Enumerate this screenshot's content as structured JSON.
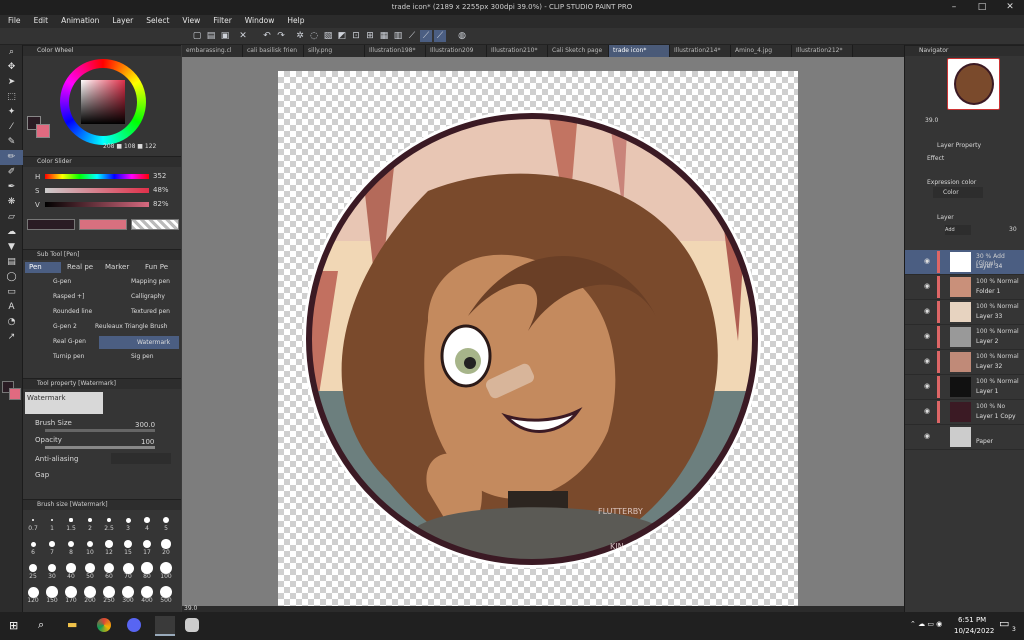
{
  "window": {
    "title": "trade icon* (2189 x 2255px 300dpi 39.0%) - CLIP STUDIO PAINT PRO",
    "minimize": "–",
    "maximize": "□",
    "close": "✕"
  },
  "menu": [
    "File",
    "Edit",
    "Animation",
    "Layer",
    "Select",
    "View",
    "Filter",
    "Window",
    "Help"
  ],
  "tabs": [
    {
      "label": "embarassing.cl"
    },
    {
      "label": "cali basilisk frien"
    },
    {
      "label": "silly.png"
    },
    {
      "label": "Illustration198*"
    },
    {
      "label": "Illustration209"
    },
    {
      "label": "Illustration210*"
    },
    {
      "label": "Cali Sketch page"
    },
    {
      "label": "trade icon*",
      "active": true
    },
    {
      "label": "Illustration214*"
    },
    {
      "label": "Amino_4.jpg"
    },
    {
      "label": "Illustration212*"
    }
  ],
  "color_wheel": {
    "title": "Color Wheel",
    "h": "208",
    "s": "108",
    "v": "122",
    "main_color": "#2a1c24",
    "sub_color": "#e06a80"
  },
  "color_slider": {
    "title": "Color Slider",
    "h_label": "H",
    "s_label": "S",
    "v_label": "V",
    "h": "352",
    "s": "48%",
    "v": "82%"
  },
  "sub_tool": {
    "title": "Sub Tool [Pen]",
    "tabs": [
      "Pen",
      "Real pe",
      "Marker",
      "Fun Pe"
    ],
    "brushes": [
      "G-pen",
      "Mapping pen",
      "Rasped +]",
      "Calligraphy",
      "Rounded line",
      "Textured pen",
      "G-pen 2",
      "Reuleaux Triangle Brush",
      "Real G-pen",
      "Watermark",
      "Turnip pen",
      "Sig pen"
    ]
  },
  "tool_property": {
    "title": "Tool property [Watermark]",
    "preset_name": "Watermark",
    "brush_size_label": "Brush Size",
    "brush_size": "300.0",
    "opacity_label": "Opacity",
    "opacity": "100",
    "antialias_label": "Anti-aliasing",
    "gap_label": "Gap"
  },
  "brush_size_panel": {
    "title": "Brush size [Watermark]",
    "sizes": [
      "0.7",
      "1",
      "1.5",
      "2",
      "2.5",
      "3",
      "4",
      "5",
      "6",
      "7",
      "8",
      "10",
      "12",
      "15",
      "17",
      "20",
      "25",
      "30",
      "40",
      "50",
      "60",
      "70",
      "80",
      "100",
      "120",
      "150",
      "170",
      "200",
      "250",
      "300",
      "400",
      "500"
    ]
  },
  "zoom": {
    "value": "39.0"
  },
  "navigator": {
    "title": "Navigator",
    "zoom": "39.0"
  },
  "layer_property": {
    "title": "Layer Property",
    "effect_label": "Effect",
    "expression_color_label": "Expression color",
    "expression_color": "Color"
  },
  "layer_panel": {
    "title": "Layer",
    "blend": "Add (Glow)",
    "opacity": "30",
    "layers": [
      {
        "mode": "30 % Add (Glow)",
        "name": "Layer 34",
        "selected": true
      },
      {
        "mode": "100 % Normal",
        "name": "Folder 1"
      },
      {
        "mode": "100 % Normal",
        "name": "Layer 33"
      },
      {
        "mode": "100 % Normal",
        "name": "Layer 2"
      },
      {
        "mode": "100 % Normal",
        "name": "Layer 32"
      },
      {
        "mode": "100 % Normal",
        "name": "Layer 1"
      },
      {
        "mode": "100 % No",
        "name": "Layer 1 Copy"
      },
      {
        "mode": "",
        "name": "Paper"
      }
    ]
  },
  "taskbar": {
    "time": "6:51 PM",
    "date": "10/24/2022",
    "badge": "3"
  },
  "watermark": {
    "line1": "FLUTTERBY",
    "line2": "KIN"
  },
  "colors": {
    "accent": "#4b5e82",
    "panel": "#353535",
    "ring": "#3b1a24",
    "hair": "#7a4a2c",
    "skin": "#c48a5e"
  }
}
